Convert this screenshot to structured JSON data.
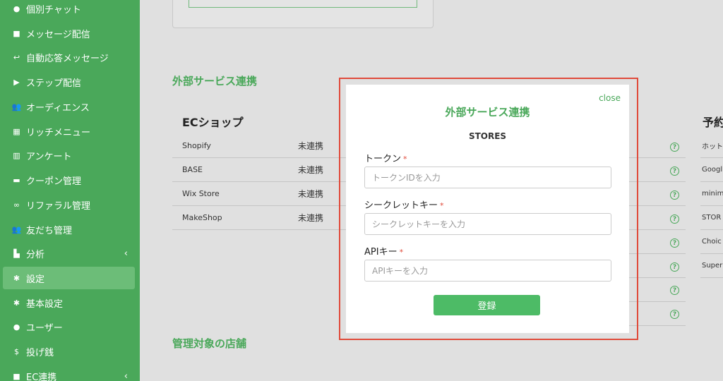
{
  "sidebar": {
    "items": [
      {
        "label": "個別チャット",
        "icon": "chat-bubble-icon",
        "glyph": "●"
      },
      {
        "label": "メッセージ配信",
        "icon": "message-icon",
        "glyph": "■"
      },
      {
        "label": "自動応答メッセージ",
        "icon": "reply-icon",
        "glyph": "↩"
      },
      {
        "label": "ステップ配信",
        "icon": "play-circle-icon",
        "glyph": "▶"
      },
      {
        "label": "オーディエンス",
        "icon": "users-icon",
        "glyph": "👥"
      },
      {
        "label": "リッチメニュー",
        "icon": "grid-icon",
        "glyph": "▦"
      },
      {
        "label": "アンケート",
        "icon": "survey-chart-icon",
        "glyph": "▥"
      },
      {
        "label": "クーポン管理",
        "icon": "ticket-icon",
        "glyph": "▬"
      },
      {
        "label": "リファラル管理",
        "icon": "link-icon",
        "glyph": "∞"
      },
      {
        "label": "友だち管理",
        "icon": "friends-icon",
        "glyph": "👥"
      },
      {
        "label": "分析",
        "icon": "analytics-chart-icon",
        "glyph": "▙",
        "chevron": "‹"
      },
      {
        "label": "設定",
        "icon": "gear-icon",
        "glyph": "✱"
      },
      {
        "label": "基本設定",
        "icon": "gear-icon",
        "glyph": "✱"
      },
      {
        "label": "ユーザー",
        "icon": "user-icon",
        "glyph": "●"
      },
      {
        "label": "投げ銭",
        "icon": "dollar-icon",
        "glyph": "$"
      },
      {
        "label": "EC連携",
        "icon": "shopping-bag-icon",
        "glyph": "■",
        "chevron": "‹"
      }
    ]
  },
  "main": {
    "section_external": "外部サービス連携",
    "section_stores": "管理対象の店舗",
    "ec_title": "ECショップ",
    "ec_rows": [
      {
        "name": "Shopify",
        "status": "未連携"
      },
      {
        "name": "BASE",
        "status": "未連携"
      },
      {
        "name": "Wix Store",
        "status": "未連携"
      },
      {
        "name": "MakeShop",
        "status": "未連携"
      }
    ],
    "reservation_title": "予約",
    "reservation_rows": [
      "ホット",
      "Googl",
      "minim",
      "STOR",
      "Choic",
      "Super"
    ],
    "help_glyph": "?"
  },
  "modal": {
    "close_label": "close",
    "title": "外部サービス連携",
    "subtitle": "STORES",
    "required_mark": "*",
    "fields": [
      {
        "label": "トークン",
        "placeholder": "トークンIDを入力"
      },
      {
        "label": "シークレットキー",
        "placeholder": "シークレットキーを入力"
      },
      {
        "label": "APIキー",
        "placeholder": "APIキーを入力"
      }
    ],
    "submit_label": "登録"
  },
  "colors": {
    "sidebar": "#4aa85a",
    "accent": "#4aa85a",
    "submit": "#4dbb66",
    "highlight": "#e04a3a",
    "required": "#e04a3a"
  }
}
